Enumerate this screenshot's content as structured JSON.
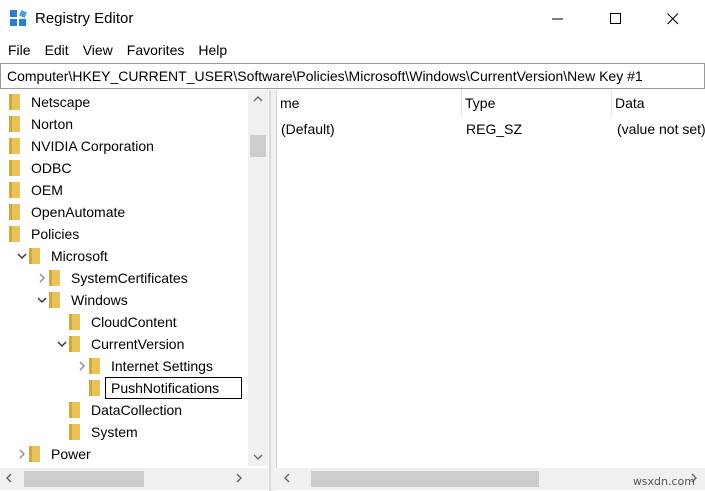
{
  "window": {
    "title": "Registry Editor"
  },
  "menu": [
    "File",
    "Edit",
    "View",
    "Favorites",
    "Help"
  ],
  "address": "Computer\\HKEY_CURRENT_USER\\Software\\Policies\\Microsoft\\Windows\\CurrentVersion\\New Key #1",
  "tree": [
    {
      "label": "Netscape",
      "level": 0,
      "arrow": "none"
    },
    {
      "label": "Norton",
      "level": 0,
      "arrow": "none"
    },
    {
      "label": "NVIDIA Corporation",
      "level": 0,
      "arrow": "none"
    },
    {
      "label": "ODBC",
      "level": 0,
      "arrow": "none"
    },
    {
      "label": "OEM",
      "level": 0,
      "arrow": "none"
    },
    {
      "label": "OpenAutomate",
      "level": 0,
      "arrow": "none"
    },
    {
      "label": "Policies",
      "level": 0,
      "arrow": "none"
    },
    {
      "label": "Microsoft",
      "level": 1,
      "arrow": "expanded"
    },
    {
      "label": "SystemCertificates",
      "level": 2,
      "arrow": "collapsed"
    },
    {
      "label": "Windows",
      "level": 2,
      "arrow": "expanded"
    },
    {
      "label": "CloudContent",
      "level": 3,
      "arrow": "none"
    },
    {
      "label": "CurrentVersion",
      "level": 3,
      "arrow": "expanded"
    },
    {
      "label": "Internet Settings",
      "level": 4,
      "arrow": "collapsed"
    },
    {
      "label": "PushNotifications",
      "level": 4,
      "arrow": "none",
      "editing": true
    },
    {
      "label": "DataCollection",
      "level": 3,
      "arrow": "none"
    },
    {
      "label": "System",
      "level": 3,
      "arrow": "none"
    },
    {
      "label": "Power",
      "level": 1,
      "arrow": "collapsed"
    }
  ],
  "columns": {
    "name": "me",
    "type": "Type",
    "data": "Data"
  },
  "values": [
    {
      "name": "(Default)",
      "type": "REG_SZ",
      "data": "(value not set)"
    }
  ],
  "watermark": "wsxdn.com",
  "colors": {
    "folder": "#e8c25a",
    "folder_dark": "#d3a73a",
    "scrollbar": "#f0f0f0",
    "thumb": "#cdcdcd"
  }
}
